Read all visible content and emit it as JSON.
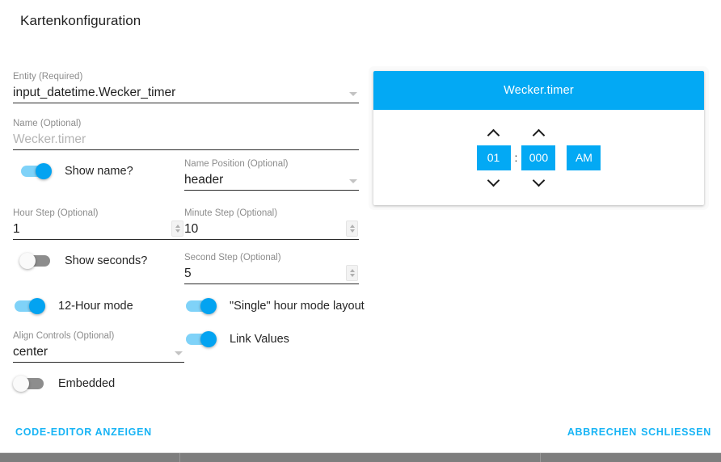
{
  "dialog": {
    "title": "Kartenkonfiguration"
  },
  "form": {
    "entity": {
      "label": "Entity (Required)",
      "value": "input_datetime.Wecker_timer"
    },
    "name": {
      "label": "Name (Optional)",
      "placeholder": "Wecker.timer"
    },
    "show_name": {
      "label": "Show name?",
      "state": "on"
    },
    "name_position": {
      "label": "Name Position (Optional)",
      "value": "header"
    },
    "hour_step": {
      "label": "Hour Step (Optional)",
      "value": "1"
    },
    "minute_step": {
      "label": "Minute Step (Optional)",
      "value": "10"
    },
    "show_seconds": {
      "label": "Show seconds?",
      "state": "off"
    },
    "second_step": {
      "label": "Second Step (Optional)",
      "value": "5"
    },
    "twelve_hour_mode": {
      "label": "12-Hour mode",
      "state": "on"
    },
    "single_hour_layout": {
      "label": "\"Single\" hour mode layout",
      "state": "on"
    },
    "align_controls": {
      "label": "Align Controls (Optional)",
      "value": "center"
    },
    "link_values": {
      "label": "Link Values",
      "state": "on"
    },
    "embedded": {
      "label": "Embedded",
      "state": "off"
    }
  },
  "preview": {
    "card_title": "Wecker.timer",
    "hour": "01",
    "separator": ":",
    "minute": "000",
    "ampm": "AM"
  },
  "footer": {
    "code_editor": "Code-Editor anzeigen",
    "cancel": "Abbrechen",
    "close": "Schliessen"
  },
  "colors": {
    "accent": "#03a9f4",
    "link": "#18b4f5",
    "switch_on_track": "#7fd2f8",
    "switch_on_thumb": "#03a3f1",
    "switch_off_track": "#8d8d8d"
  }
}
